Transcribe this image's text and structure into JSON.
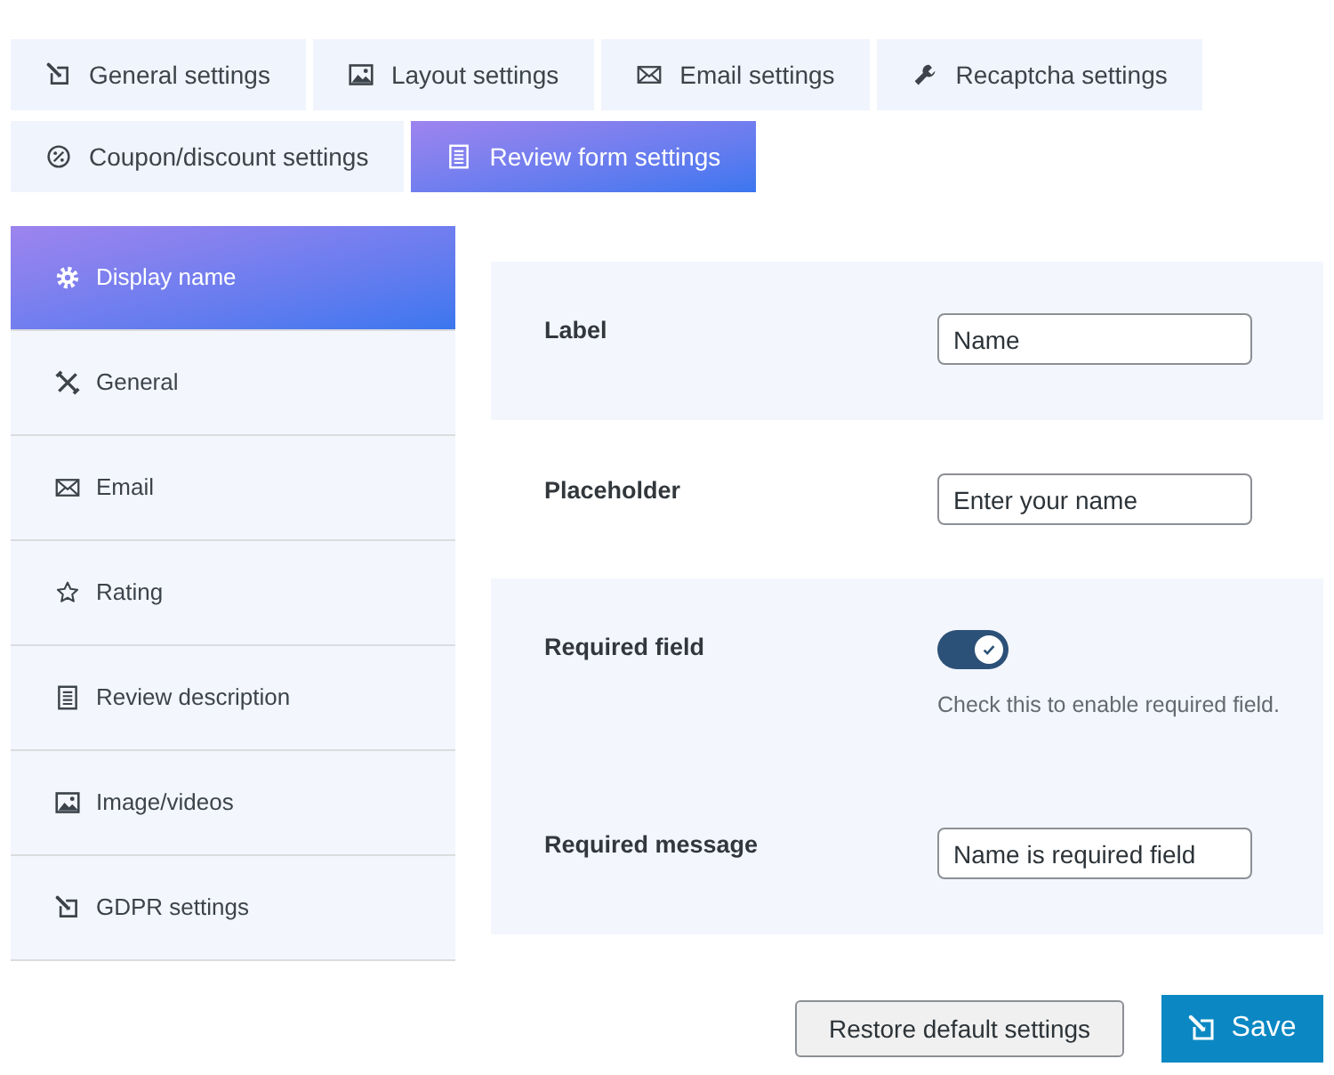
{
  "tabs": [
    {
      "label": "General settings",
      "selected": false
    },
    {
      "label": "Layout settings",
      "selected": false
    },
    {
      "label": "Email settings",
      "selected": false
    },
    {
      "label": "Recaptcha settings",
      "selected": false
    },
    {
      "label": "Coupon/discount settings",
      "selected": false
    },
    {
      "label": "Review form settings",
      "selected": true
    }
  ],
  "sidebar": {
    "items": [
      {
        "label": "Display name",
        "selected": true
      },
      {
        "label": "General",
        "selected": false
      },
      {
        "label": "Email",
        "selected": false
      },
      {
        "label": "Rating",
        "selected": false
      },
      {
        "label": "Review description",
        "selected": false
      },
      {
        "label": "Image/videos",
        "selected": false
      },
      {
        "label": "GDPR settings",
        "selected": false
      }
    ]
  },
  "form": {
    "sections": [
      {
        "fields": [
          {
            "kind": "text",
            "label": "Label",
            "value": "Name"
          }
        ]
      },
      {
        "fields": [
          {
            "kind": "text",
            "label": "Placeholder",
            "value": "Enter your name"
          }
        ]
      },
      {
        "fields": [
          {
            "kind": "toggle",
            "label": "Required field",
            "on": true,
            "help": "Check this to enable required field."
          },
          {
            "kind": "text",
            "label": "Required message",
            "value": "Name is required field"
          }
        ]
      }
    ]
  },
  "buttons": [
    {
      "kind": "secondary",
      "label": "Restore default settings"
    },
    {
      "kind": "primary",
      "label": "Save"
    }
  ]
}
